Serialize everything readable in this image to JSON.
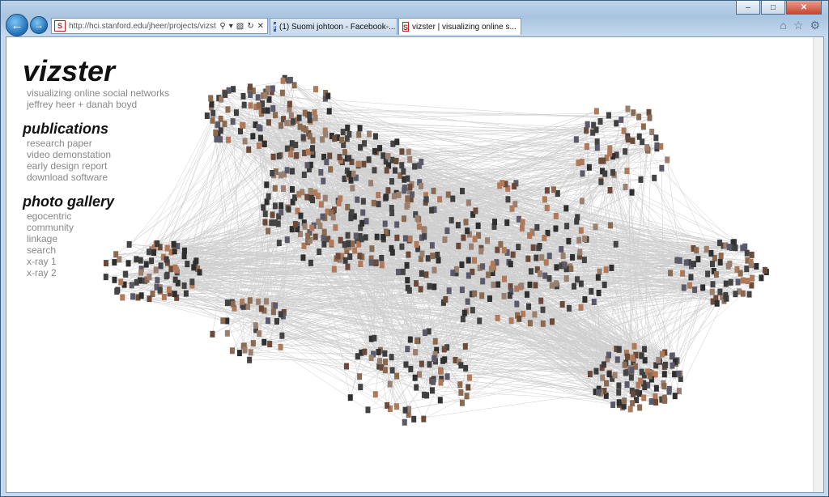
{
  "browser": {
    "address_url": "http://hci.stanford.edu/jheer/projects/vizst",
    "tabs": [
      {
        "label": "(1) Suomi johtoon - Facebook-...",
        "icon": "facebook-icon"
      },
      {
        "label": "vizster | visualizing online s...",
        "icon": "site-icon"
      }
    ],
    "accent": "#1f6fb5"
  },
  "page": {
    "title": "vizster",
    "subtitle_lines": [
      "visualizing online social networks",
      "jeffrey heer + danah boyd"
    ],
    "publications": {
      "heading": "publications",
      "links": [
        "research paper",
        "video demonstation",
        "early design report",
        "download software"
      ]
    },
    "gallery": {
      "heading": "photo gallery",
      "links": [
        "egocentric",
        "community",
        "linkage",
        "search",
        "x-ray 1",
        "x-ray 2"
      ]
    }
  }
}
